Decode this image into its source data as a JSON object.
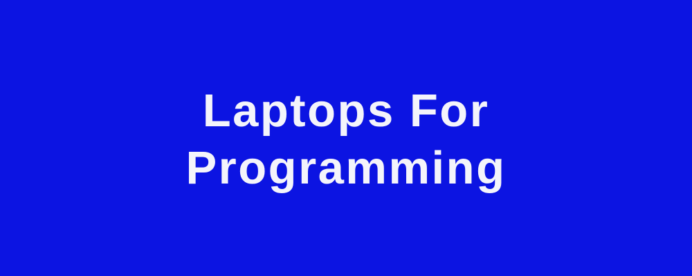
{
  "banner": {
    "background_color": "#0c14e2",
    "text_color": "#f4f4fb",
    "title_line_1": "Laptops For",
    "title_line_2": "Programming"
  }
}
